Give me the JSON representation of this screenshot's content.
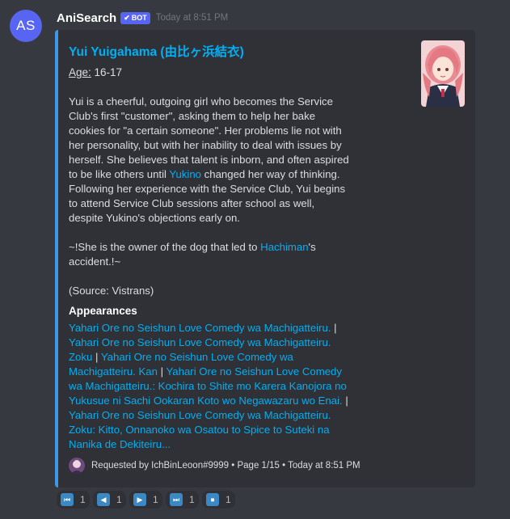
{
  "author": {
    "avatar_initials": "AS",
    "name": "AniSearch",
    "badge": "BOT",
    "timestamp": "Today at 8:51 PM"
  },
  "colors": {
    "embed_border": "#3c98e8",
    "link": "#00aff4",
    "badge": "#5865f2",
    "background": "#36393f",
    "embed_bg": "#2f3136"
  },
  "embed": {
    "title": "Yui Yuigahama (由比ヶ浜結衣)",
    "thumbnail_icon": "character-portrait-icon",
    "age_label": "Age:",
    "age_value": " 16-17",
    "description": {
      "p1_a": "Yui is a cheerful, outgoing girl who becomes the Service Club's first \"customer\", asking them to help her bake cookies for \"a certain someone\". Her problems lie not with her personality, but with her inability to deal with issues by herself. She believes that talent is inborn, and often aspired to be like others until ",
      "p1_link": "Yukino",
      "p1_b": " changed her way of thinking. Following her experience with the Service Club, Yui begins to attend Service Club sessions after school as well, despite Yukino's objections early on.",
      "p2_a": "~!She is the owner of the dog that led to ",
      "p2_link": "Hachiman",
      "p2_b": "'s accident.!~",
      "p3": "(Source: Vistrans)"
    },
    "field_name": "Appearances",
    "appearances": [
      "Yahari Ore no Seishun Love Comedy wa Machigatteiru.",
      "Yahari Ore no Seishun Love Comedy wa Machigatteiru. Zoku",
      "Yahari Ore no Seishun Love Comedy wa Machigatteiru. Kan",
      "Yahari Ore no Seishun Love Comedy wa Machigatteiru.: Kochira to Shite mo Karera Kanojora no Yukusue ni Sachi Ookaran Koto wo Negawazaru wo Enai.",
      "Yahari Ore no Seishun Love Comedy wa Machigatteiru. Zoku: Kitto, Onnanoko wa Osatou to Spice to Suteki na Nanika de Dekiteiru..."
    ],
    "separator": " | ",
    "footer": "Requested by IchBinLeoon#9999 • Page 1/15 • Today at 8:51 PM"
  },
  "reactions": [
    {
      "icon": "⏮",
      "name": "first-page",
      "count": "1"
    },
    {
      "icon": "◀",
      "name": "previous-page",
      "count": "1"
    },
    {
      "icon": "▶",
      "name": "next-page",
      "count": "1"
    },
    {
      "icon": "⏭",
      "name": "last-page",
      "count": "1"
    },
    {
      "icon": "⏹",
      "name": "stop",
      "count": "1"
    }
  ]
}
